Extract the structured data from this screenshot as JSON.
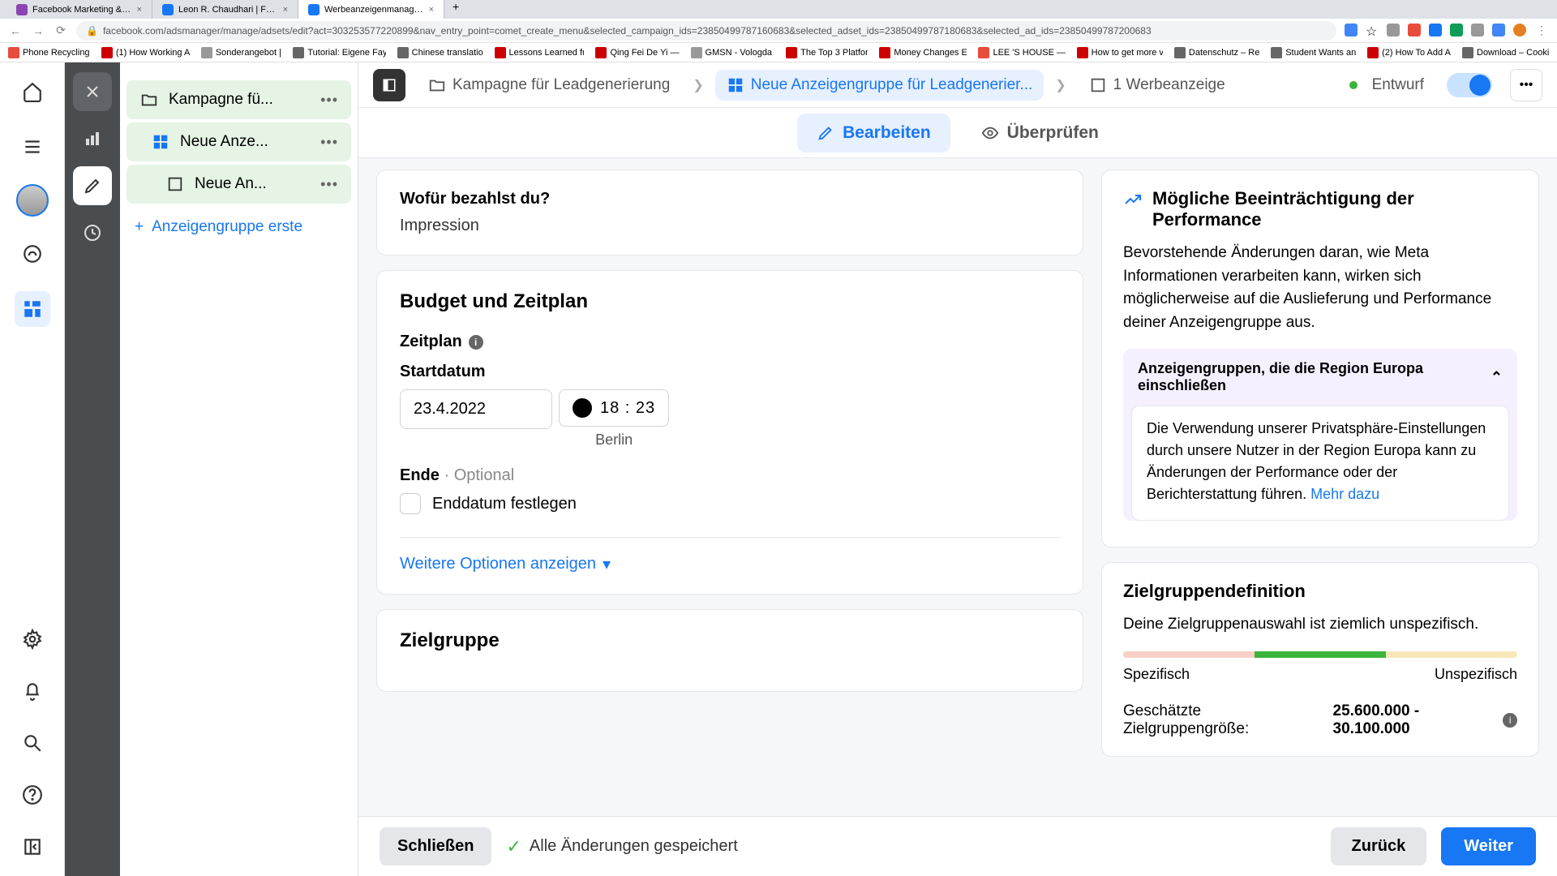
{
  "browser": {
    "tabs": [
      {
        "title": "Facebook Marketing & Werbe...",
        "favicon": "#8c44b5"
      },
      {
        "title": "Leon R. Chaudhari | Facebook",
        "favicon": "#1877f2"
      },
      {
        "title": "Werbeanzeigenmanager - We...",
        "favicon": "#1877f2",
        "active": true
      }
    ],
    "url": "facebook.com/adsmanager/manage/adsets/edit?act=303253577220899&nav_entry_point=comet_create_menu&selected_campaign_ids=23850499787160683&selected_adset_ids=23850499787180683&selected_ad_ids=23850499787200683",
    "bookmarks": [
      {
        "label": "Phone Recycling...",
        "color": "#e74c3c"
      },
      {
        "label": "(1) How Working A...",
        "color": "#cc0000"
      },
      {
        "label": "Sonderangebot |...",
        "color": "#999"
      },
      {
        "label": "Tutorial: Eigene Fay...",
        "color": "#666"
      },
      {
        "label": "Chinese translatio...",
        "color": "#666"
      },
      {
        "label": "Lessons Learned fr...",
        "color": "#cc0000"
      },
      {
        "label": "Qing Fei De Yi —...",
        "color": "#cc0000"
      },
      {
        "label": "GMSN - Vologda ...",
        "color": "#999"
      },
      {
        "label": "The Top 3 Platfor...",
        "color": "#cc0000"
      },
      {
        "label": "Money Changes E...",
        "color": "#cc0000"
      },
      {
        "label": "LEE 'S HOUSE —...",
        "color": "#e74c3c"
      },
      {
        "label": "How to get more v...",
        "color": "#cc0000"
      },
      {
        "label": "Datenschutz – Re...",
        "color": "#666"
      },
      {
        "label": "Student Wants an...",
        "color": "#666"
      },
      {
        "label": "(2) How To Add A...",
        "color": "#cc0000"
      },
      {
        "label": "Download – Cooki...",
        "color": "#666"
      }
    ]
  },
  "tree": {
    "items": [
      {
        "label": "Kampagne fü...",
        "type": "campaign",
        "selected": true,
        "indent": 0
      },
      {
        "label": "Neue Anze...",
        "type": "adset",
        "selected": true,
        "indent": 1
      },
      {
        "label": "Neue An...",
        "type": "ad",
        "selected": true,
        "indent": 2
      }
    ],
    "create_label": "Anzeigengruppe erste"
  },
  "breadcrumb": {
    "campaign": "Kampagne für Leadgenerierung",
    "adset": "Neue Anzeigengruppe für Leadgenerier...",
    "ad": "1 Werbeanzeige",
    "status": "Entwurf"
  },
  "subtabs": {
    "edit": "Bearbeiten",
    "review": "Überprüfen"
  },
  "pay_card": {
    "title": "Wofür bezahlst du?",
    "value": "Impression"
  },
  "budget_card": {
    "title": "Budget und Zeitplan",
    "schedule_label": "Zeitplan",
    "start_label": "Startdatum",
    "start_date": "23.4.2022",
    "start_time": "18 : 23",
    "tz": "Berlin",
    "end_label": "Ende",
    "optional": "Optional",
    "set_end": "Enddatum festlegen",
    "more_options": "Weitere Optionen anzeigen"
  },
  "audience_card": {
    "title": "Zielgruppe"
  },
  "performance": {
    "title": "Mögliche Beeinträchtigung der Performance",
    "text": "Bevorstehende Änderungen daran, wie Meta Informationen verarbeiten kann, wirken sich möglicherweise auf die Auslieferung und Performance deiner Anzeigengruppe aus.",
    "acc_title": "Anzeigengruppen, die die Region Europa einschließen",
    "acc_text": "Die Verwendung unserer Privatsphäre-Einstellungen durch unsere Nutzer in der Region Europa kann zu Änderungen der Performance oder der Berichterstattung führen. ",
    "learn_more": "Mehr dazu"
  },
  "definition": {
    "title": "Zielgruppendefinition",
    "text": "Deine Zielgruppenauswahl ist ziemlich unspezifisch.",
    "specific": "Spezifisch",
    "unspecific": "Unspezifisch",
    "estimate_label": "Geschätzte Zielgruppengröße: ",
    "estimate_value": "25.600.000 - 30.100.000"
  },
  "footer": {
    "close": "Schließen",
    "saved": "Alle Änderungen gespeichert",
    "back": "Zurück",
    "next": "Weiter"
  }
}
